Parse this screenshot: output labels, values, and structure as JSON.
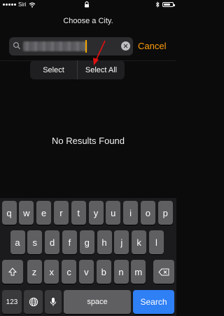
{
  "status_bar": {
    "carrier": "Siri",
    "wifi_icon": "wifi-icon",
    "lock_icon": "lock-icon",
    "bluetooth_icon": "bluetooth-icon",
    "battery_level": 0.75
  },
  "header": {
    "title": "Choose a City."
  },
  "search": {
    "value": "",
    "clear_icon": "clear-icon",
    "cancel_label": "Cancel",
    "accent": "#ff9f0a"
  },
  "edit_menu": {
    "select_label": "Select",
    "select_all_label": "Select All"
  },
  "results": {
    "empty_message": "No Results Found"
  },
  "keyboard": {
    "row1": [
      "q",
      "w",
      "e",
      "r",
      "t",
      "y",
      "u",
      "i",
      "o",
      "p"
    ],
    "row2": [
      "a",
      "s",
      "d",
      "f",
      "g",
      "h",
      "j",
      "k",
      "l"
    ],
    "row3": [
      "z",
      "x",
      "c",
      "v",
      "b",
      "n",
      "m"
    ],
    "numbers_label": "123",
    "space_label": "space",
    "search_label": "Search",
    "search_color": "#2f7ff5"
  }
}
